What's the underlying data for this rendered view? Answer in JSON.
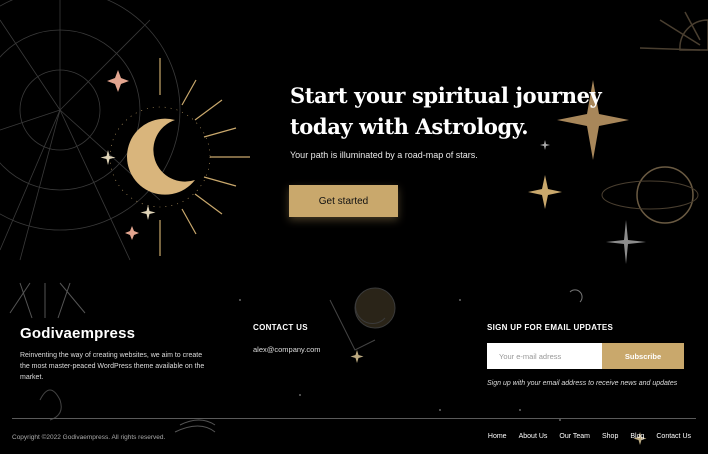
{
  "hero": {
    "title": "Start your spiritual journey today with Astrology.",
    "subtitle": "Your path is illuminated by a road-map of stars.",
    "cta_label": "Get started"
  },
  "footer": {
    "brand": "Godivaempress",
    "description": "Reinventing the way of creating websites, we aim to create the most master-peaced WordPress theme available on the market.",
    "contact": {
      "title": "CONTACT US",
      "email": "alex@company.com"
    },
    "signup": {
      "title": "SIGN UP FOR EMAIL UPDATES",
      "placeholder": "Your e-mail adress",
      "button_label": "Subscribe",
      "note": "Sign up with your email address to receive news and updates"
    },
    "copyright": "Copyright ©2022 Godivaempress. All rights reserved.",
    "nav": [
      "Home",
      "About Us",
      "Our Team",
      "Shop",
      "Blog",
      "Contact Us"
    ]
  },
  "colors": {
    "background": "#000000",
    "accent_gold": "#c9a86c",
    "accent_rose": "#e3a58f",
    "muted_line": "#5a5a5a"
  }
}
